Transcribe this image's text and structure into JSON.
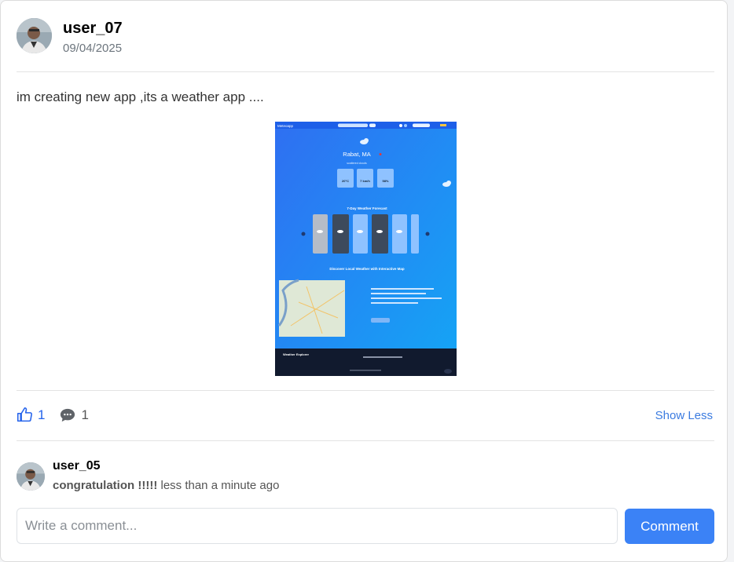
{
  "post": {
    "author": "user_07",
    "date": "09/04/2025",
    "text": "im creating new app ,its a weather app ....",
    "likes": "1",
    "comments_count": "1",
    "toggle_label": "Show Less"
  },
  "screenshot": {
    "brand": "Meteoapp",
    "city": "Rabat, MA",
    "description": "scattered clouds",
    "stats": [
      "20°C",
      "7 km/h",
      "58%"
    ],
    "forecast_title": "7-Day Weather Forecast",
    "map_title": "Discover Local Weather with Interactive Map",
    "footer_brand": "Weather Explorer"
  },
  "comment": {
    "author": "user_05",
    "text": "congratulation !!!!!",
    "time": "less than a minute ago"
  },
  "composer": {
    "placeholder": "Write a comment...",
    "button_label": "Comment"
  },
  "colors": {
    "accent": "#3b82f6",
    "link": "#3b7be0"
  }
}
